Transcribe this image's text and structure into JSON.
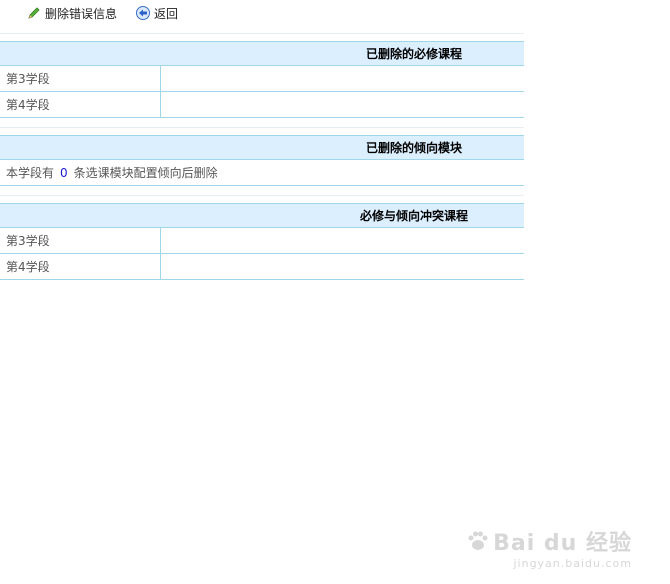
{
  "toolbar": {
    "delete_label": "删除错误信息",
    "back_label": "返回"
  },
  "sections": {
    "removed_required": {
      "title": "已删除的必修课程",
      "rows": [
        {
          "label": "第3学段",
          "value": ""
        },
        {
          "label": "第4学段",
          "value": ""
        }
      ]
    },
    "removed_tendency": {
      "title": "已删除的倾向模块",
      "message_prefix": "本学段有",
      "count": "0",
      "message_suffix": "条选课模块配置倾向后删除"
    },
    "conflict": {
      "title": "必修与倾向冲突课程",
      "rows": [
        {
          "label": "第3学段",
          "value": ""
        },
        {
          "label": "第4学段",
          "value": ""
        }
      ]
    }
  },
  "watermark": {
    "brand": "Bai du 经验",
    "url": "jingyan.baidu.com"
  },
  "colors": {
    "header_bg": "#dcefff",
    "border": "#9fd6ea",
    "count": "#1a1ad6"
  }
}
